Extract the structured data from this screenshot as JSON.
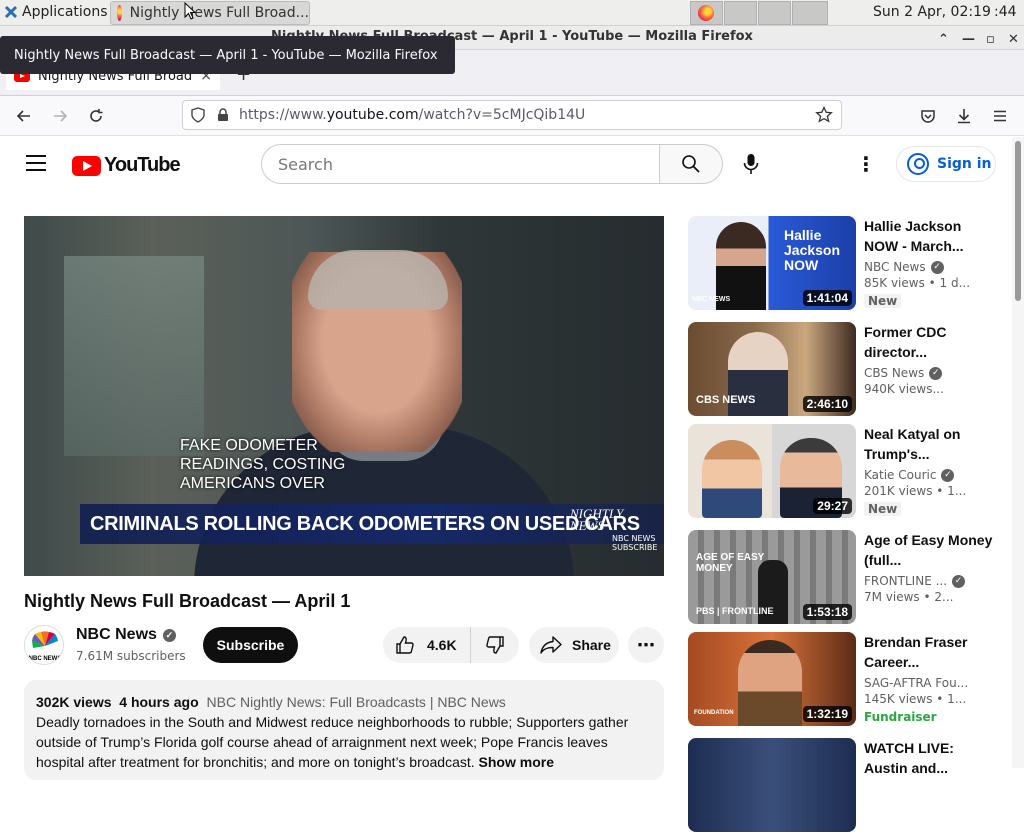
{
  "taskbar": {
    "apps_label": "Applications",
    "task_title": "Nightly News Full Broad...",
    "clock": "Sun  2 Apr, 02:19",
    "seconds": ":44"
  },
  "window": {
    "title": "Nightly News Full Broadcast — April 1 - YouTube — Mozilla Firefox"
  },
  "tooltip": {
    "text": "Nightly News Full Broadcast — April 1 - YouTube — Mozilla Firefox"
  },
  "tabs": [
    {
      "title": "Nightly News Full Broadc",
      "close": "×"
    }
  ],
  "newtab_label": "+",
  "urlbar": {
    "prefix": "https://www.",
    "domain": "youtube.com",
    "path": "/watch?v=5cMJcQib14U"
  },
  "youtube": {
    "logo_text": "YouTube",
    "search_placeholder": "Search",
    "signin_label": "Sign in"
  },
  "video": {
    "caption_lines": [
      "FAKE ODOMETER",
      "READINGS, COSTING",
      "AMERICANS OVER"
    ],
    "lower_third": "CRIMINALS ROLLING BACK ODOMETERS ON USED CARS",
    "watermark_line1": "NIGHTLY",
    "watermark_line2": "NEWS",
    "subscribe_line1": "NBC NEWS",
    "subscribe_line2": "SUBSCRIBE",
    "title": "Nightly News Full Broadcast — April 1"
  },
  "channel": {
    "name": "NBC News",
    "subscribers": "7.61M subscribers",
    "subscribe_label": "Subscribe",
    "likes": "4.6K",
    "share_label": "Share",
    "avatar_text": "NBC NEWS"
  },
  "description": {
    "views": "302K views",
    "age": "4 hours ago",
    "tags": "NBC Nightly News: Full Broadcasts | NBC News",
    "text": "Deadly tornadoes in the South and Midwest reduce neighborhoods to rubble; Supporters gather outside of Trump’s Florida golf course ahead of arraignment next week; Pope Francis leaves hospital after treatment for bronchitis; and more on tonight’s broadcast.",
    "show_more": "Show more"
  },
  "recommendations": [
    {
      "title": "Hallie Jackson NOW - March...",
      "channel": "NBC News",
      "verified": true,
      "meta": "85K views  • 1 d...",
      "badge": "New",
      "duration": "1:41:04",
      "thumb_text": "Hallie Jackson NOW",
      "thumb_logo": "NBC NEWS"
    },
    {
      "title": "Former CDC director...",
      "channel": "CBS News",
      "verified": true,
      "meta": "940K views...",
      "badge": "",
      "duration": "2:46:10",
      "thumb_text": "",
      "thumb_logo": "CBS NEWS"
    },
    {
      "title": "Neal Katyal on Trump's...",
      "channel": "Katie Couric",
      "verified": true,
      "meta": "201K views  • 1...",
      "badge": "New",
      "duration": "29:27",
      "thumb_text": "",
      "thumb_logo": ""
    },
    {
      "title": "Age of Easy Money (full...",
      "channel": "FRONTLINE ...",
      "verified": true,
      "meta": "7M views  • 2...",
      "badge": "",
      "duration": "1:53:18",
      "thumb_text": "AGE OF EASY MONEY",
      "thumb_logo": "PBS | FRONTLINE"
    },
    {
      "title": "Brendan Fraser Career...",
      "channel": "SAG-AFTRA Fou...",
      "verified": false,
      "meta": "145K views  • 1...",
      "badge": "Fundraiser",
      "duration": "1:32:19",
      "thumb_text": "",
      "thumb_logo": "FOUNDATION"
    },
    {
      "title": "WATCH LIVE: Austin and...",
      "channel": "",
      "verified": false,
      "meta": "",
      "badge": "",
      "duration": "",
      "thumb_text": "",
      "thumb_logo": ""
    }
  ]
}
